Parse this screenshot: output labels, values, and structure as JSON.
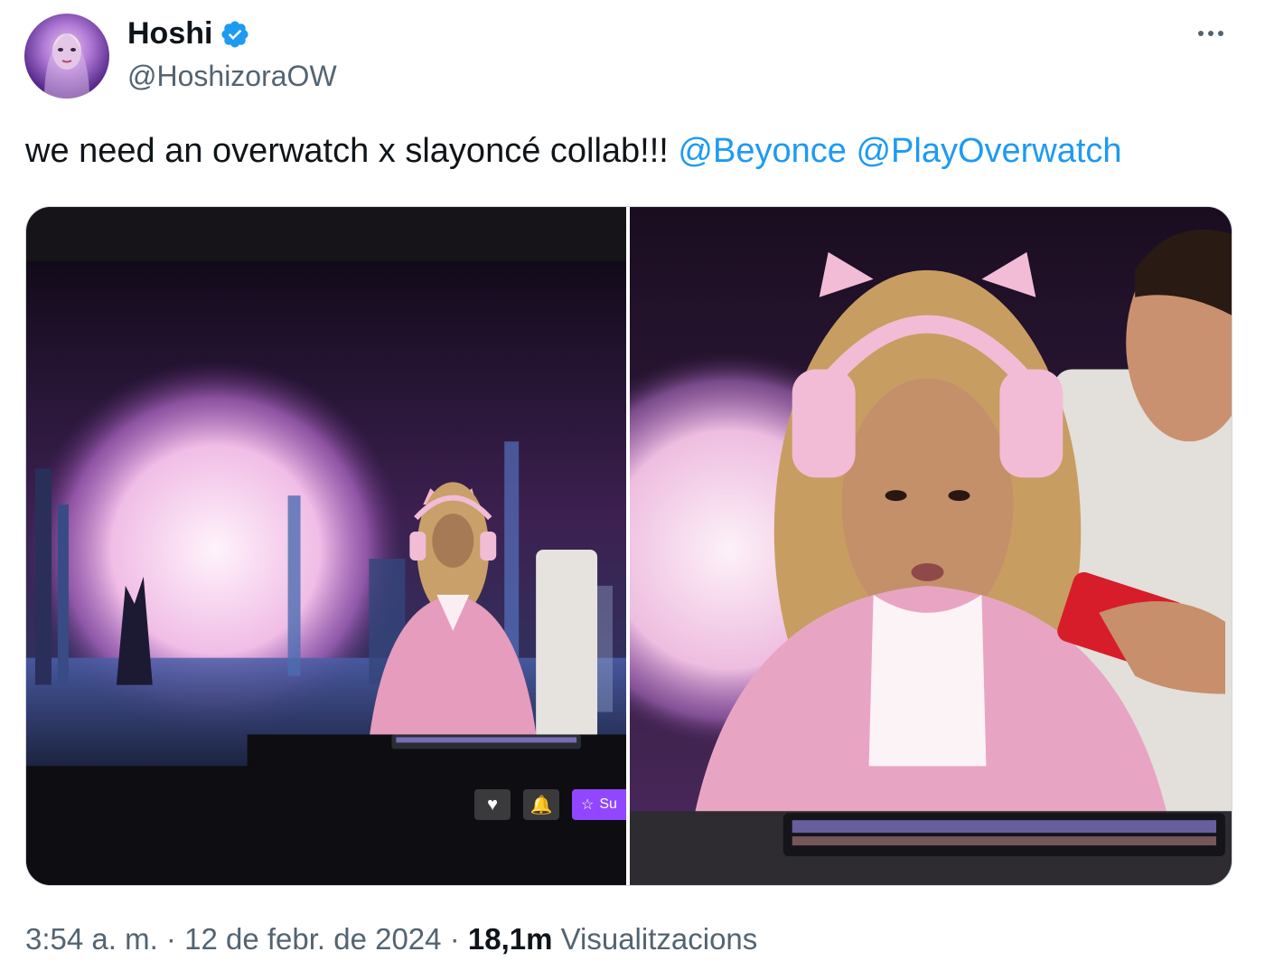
{
  "author": {
    "display_name": "Hoshi",
    "handle": "@HoshizoraOW",
    "verified": true,
    "verified_color": "#1d9bf0"
  },
  "tweet": {
    "text": "we need an overwatch x slayoncé collab!!!",
    "mentions": [
      "@Beyonce",
      "@PlayOverwatch"
    ],
    "mention_color": "#1d9bf0"
  },
  "media": {
    "photo_count": 2,
    "stream_buttons": [
      "heart-icon",
      "bell-icon",
      "star-icon"
    ],
    "subscribe_label": "Su"
  },
  "meta": {
    "time": "3:54 a. m.",
    "separator": "·",
    "date": "12 de febr. de 2024",
    "views_count": "18,1m",
    "views_label": "Visualitzacions"
  },
  "icons": {
    "more": "more-options-icon",
    "verified": "verified-badge-icon"
  }
}
